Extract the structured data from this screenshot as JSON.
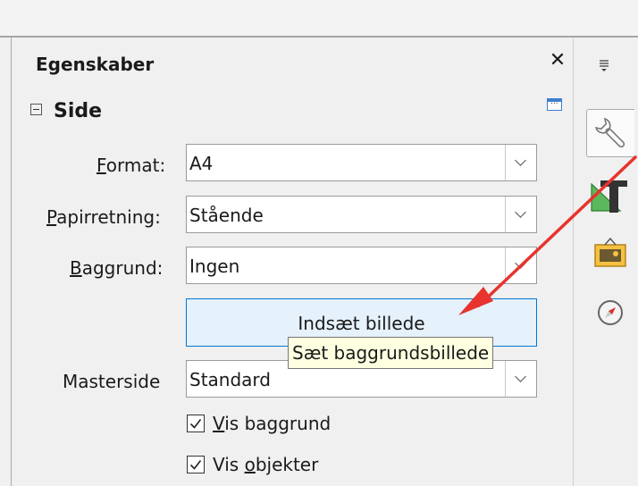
{
  "panel": {
    "title": "Egenskaber",
    "section_title": "Side"
  },
  "form": {
    "format": {
      "label_accel": "F",
      "label_rest": "ormat:",
      "value": "A4"
    },
    "orientation": {
      "label_accel": "P",
      "label_rest": "apirretning:",
      "value": "Stående"
    },
    "background": {
      "label_accel": "B",
      "label_rest": "aggrund:",
      "value": "Ingen"
    },
    "insert_image_label": "Indsæt billede",
    "tooltip": "Sæt baggrundsbillede",
    "master_page": {
      "label": "Masterside",
      "value": "Standard"
    },
    "show_background": {
      "label_accel": "V",
      "label_rest": "is baggrund",
      "checked": true
    },
    "show_objects": {
      "label_pre": "Vis ",
      "label_accel": "o",
      "label_rest": "bjekter",
      "checked": true
    }
  },
  "deck_tabs": [
    "properties",
    "styles",
    "gallery",
    "navigator"
  ],
  "colors": {
    "annotation_arrow": "#e8332e",
    "button_bg": "#e5f1fb",
    "button_border": "#0078d7",
    "tooltip_bg": "#ffffe1"
  }
}
